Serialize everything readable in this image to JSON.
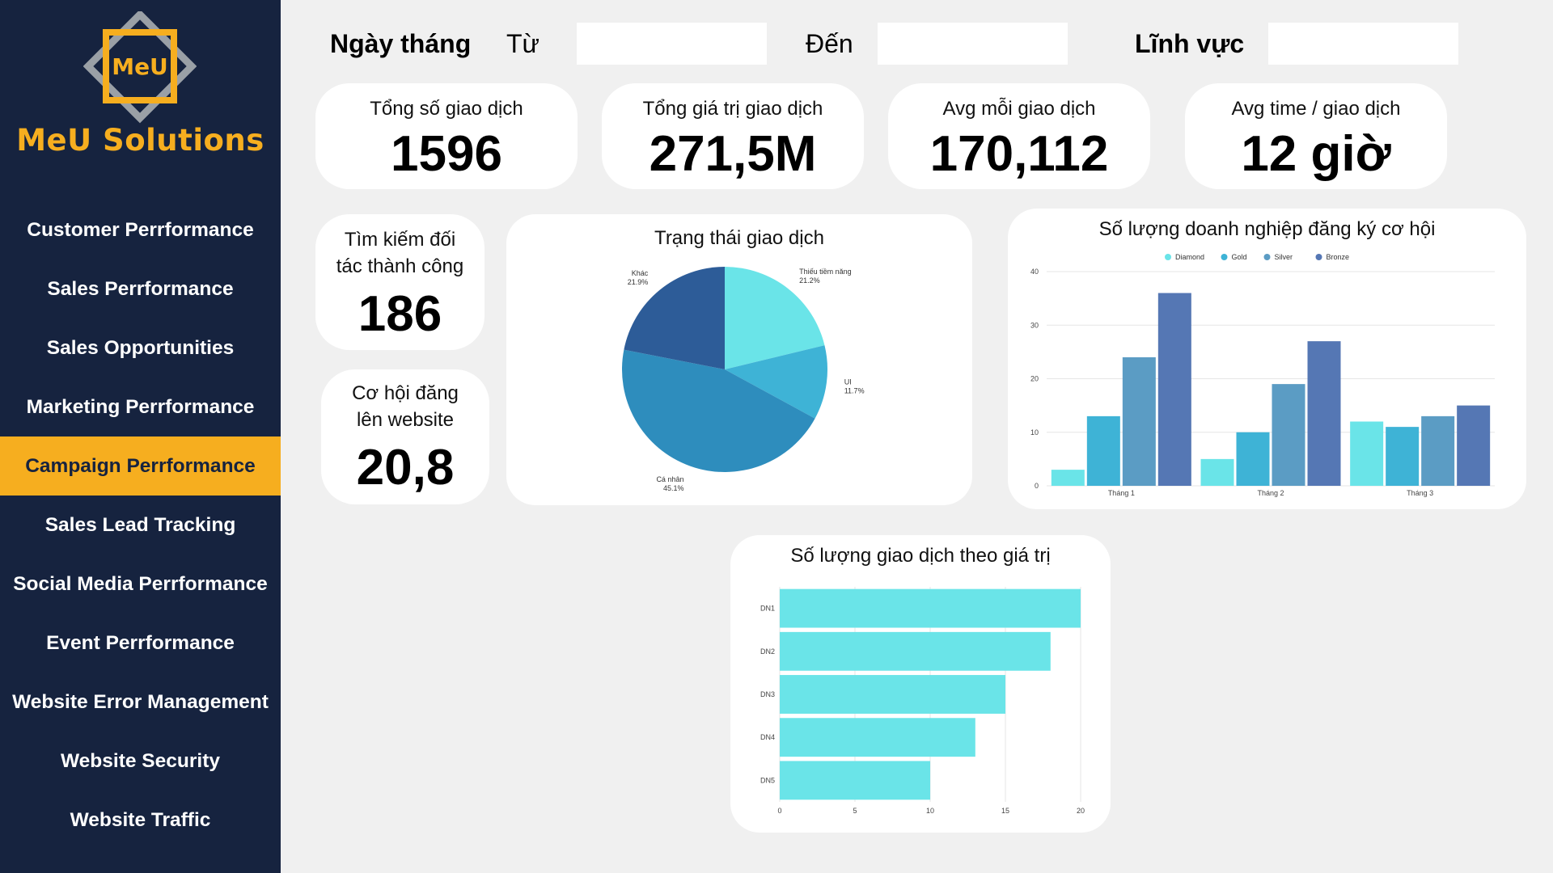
{
  "brand": {
    "logo_text": "MeU",
    "name": "MeU Solutions",
    "accent": "#f6ae1f",
    "sidebar_bg": "#16233f"
  },
  "nav": [
    {
      "label": "Customer Perrformance",
      "active": false
    },
    {
      "label": "Sales Perrformance",
      "active": false
    },
    {
      "label": "Sales Opportunities",
      "active": false
    },
    {
      "label": "Marketing Perrformance",
      "active": false
    },
    {
      "label": "Campaign Perrformance",
      "active": true
    },
    {
      "label": "Sales Lead Tracking",
      "active": false
    },
    {
      "label": "Social Media Perrformance",
      "active": false
    },
    {
      "label": "Event Perrformance",
      "active": false
    },
    {
      "label": "Website Error Management",
      "active": false
    },
    {
      "label": "Website Security",
      "active": false
    },
    {
      "label": "Website Traffic",
      "active": false
    }
  ],
  "filters": {
    "date_label": "Ngày tháng",
    "from_label": "Từ",
    "to_label": "Đến",
    "field_label": "Lĩnh vực",
    "from_value": "",
    "to_value": "",
    "field_value": ""
  },
  "kpis": {
    "total_tx": {
      "title": "Tổng số giao dịch",
      "value": "1596"
    },
    "total_value": {
      "title": "Tổng giá trị giao dịch",
      "value": "271,5M"
    },
    "avg_tx": {
      "title": "Avg mỗi giao dịch",
      "value": "170,112"
    },
    "avg_time": {
      "title": "Avg time / giao dịch",
      "value": "12 giờ"
    },
    "partner": {
      "title_line1": "Tìm kiếm đối",
      "title_line2": "tác thành công",
      "value": "186"
    },
    "website": {
      "title_line1": "Cơ hội đăng",
      "title_line2": "lên website",
      "value": "20,8"
    }
  },
  "chart_data": [
    {
      "type": "pie",
      "title": "Trạng thái giao dịch",
      "slices": [
        {
          "label": "Thiếu tiềm năng",
          "value": 21.2,
          "pct_label": "21.2%",
          "color": "#6ae4e8"
        },
        {
          "label": "UI",
          "value": 11.7,
          "pct_label": "11.7%",
          "color": "#3eb3d6"
        },
        {
          "label": "Cá nhân",
          "value": 45.1,
          "pct_label": "45.1%",
          "color": "#2e8dbd"
        },
        {
          "label": "Khác",
          "value": 21.9,
          "pct_label": "21.9%",
          "color": "#2d5c98"
        }
      ]
    },
    {
      "type": "bar",
      "title": "Số lượng doanh nghiệp đăng ký cơ hội",
      "categories": [
        "Tháng 1",
        "Tháng 2",
        "Tháng 3"
      ],
      "series": [
        {
          "name": "Diamond",
          "values": [
            3,
            5,
            12
          ],
          "color": "#6ae4e8"
        },
        {
          "name": "Gold",
          "values": [
            13,
            10,
            11
          ],
          "color": "#3eb3d6"
        },
        {
          "name": "Silver",
          "values": [
            24,
            19,
            13
          ],
          "color": "#5b9cc4"
        },
        {
          "name": "Bronze",
          "values": [
            36,
            27,
            15
          ],
          "color": "#5577b4"
        }
      ],
      "ylim": [
        0,
        40
      ],
      "yticks": [
        0,
        10,
        20,
        30,
        40
      ],
      "legend": "top",
      "grid": true
    },
    {
      "type": "bar",
      "orientation": "horizontal",
      "title": "Số lượng giao dịch theo giá trị",
      "categories": [
        "DN1",
        "DN2",
        "DN3",
        "DN4",
        "DN5"
      ],
      "values": [
        20,
        18,
        15,
        13,
        10
      ],
      "color": "#6ae4e8",
      "xlim": [
        0,
        20
      ],
      "xticks": [
        0,
        5,
        10,
        15,
        20
      ],
      "grid": true
    }
  ]
}
